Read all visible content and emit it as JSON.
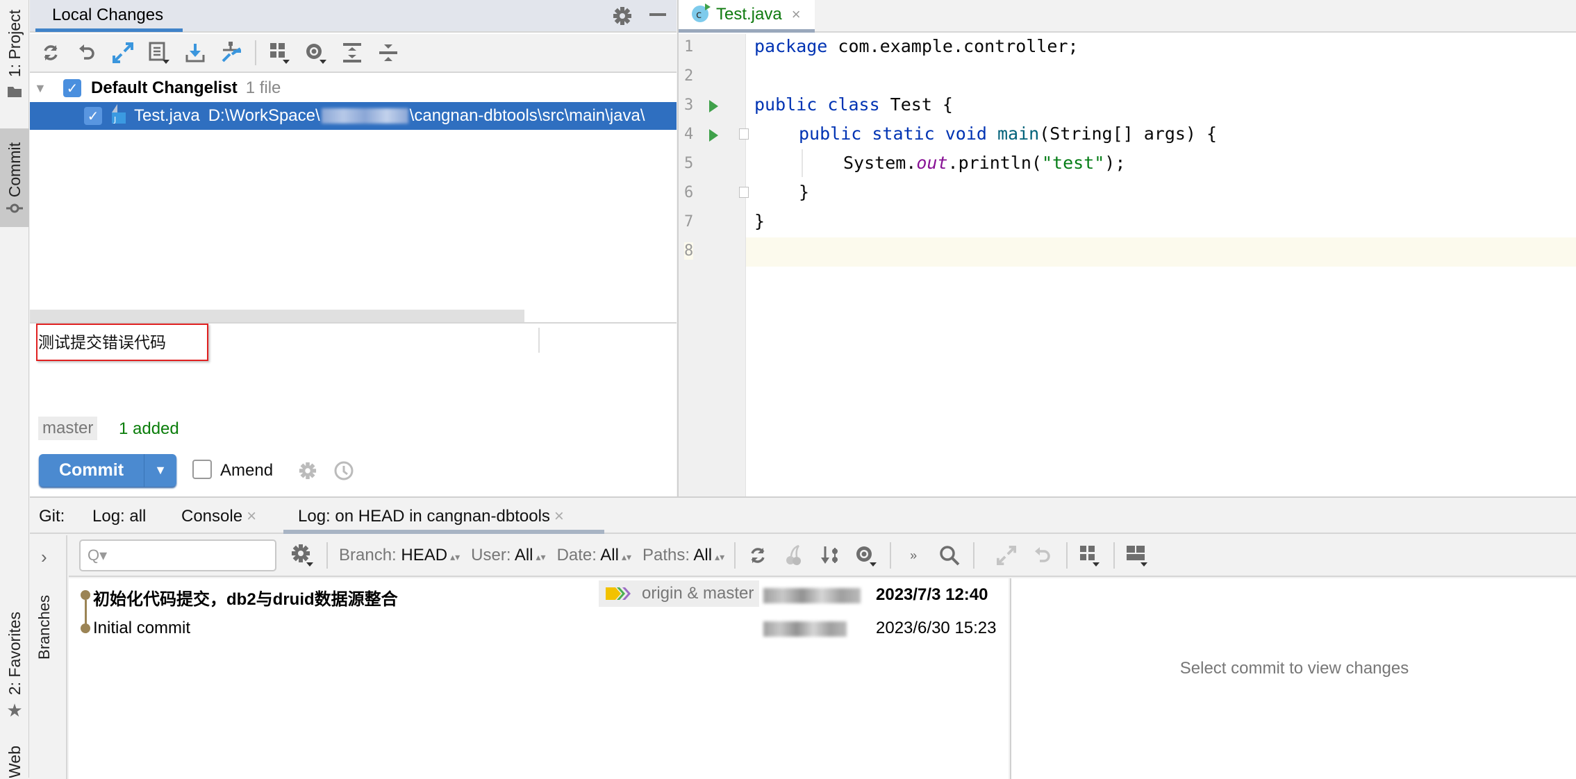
{
  "left_stripe": {
    "project_tab": "1: Project",
    "commit_tab": "Commit",
    "favorites_tab": "2: Favorites",
    "web_tab": "Web"
  },
  "local_changes": {
    "title": "Local Changes",
    "toolbar": [
      "refresh",
      "rollback",
      "show-diff",
      "changelist",
      "update",
      "shelve",
      "group-by",
      "view-options",
      "expand-all",
      "collapse-all"
    ],
    "changelist": {
      "name": "Default Changelist",
      "count": "1 file",
      "checked": true
    },
    "files": [
      {
        "name": "Test.java",
        "path_prefix": "D:\\WorkSpace\\",
        "path_suffix": "\\cangnan-dbtools\\src\\main\\java\\",
        "checked": true
      }
    ],
    "commit_message": "测试提交错误代码",
    "branch": "master",
    "status": "1 added",
    "commit_button": "Commit",
    "amend_label": "Amend",
    "amend_checked": false
  },
  "editor": {
    "tab": "Test.java",
    "lines": [
      {
        "n": "1"
      },
      {
        "n": "2"
      },
      {
        "n": "3"
      },
      {
        "n": "4"
      },
      {
        "n": "5"
      },
      {
        "n": "6"
      },
      {
        "n": "7"
      },
      {
        "n": "8"
      }
    ],
    "code": {
      "l1_kw": "package",
      "l1_rest": " com.example.controller;",
      "l3_kw": "public class",
      "l3_rest": " Test {",
      "l4_kw": "public static void",
      "l4_fn": "main",
      "l4_rest": "(String[] args) {",
      "l5_a": "System.",
      "l5_field": "out",
      "l5_b": ".println(",
      "l5_str": "\"test\"",
      "l5_c": ");",
      "l6": "}",
      "l7": "}"
    }
  },
  "git_window": {
    "label": "Git:",
    "tabs": [
      {
        "label": "Log: all",
        "closable": false
      },
      {
        "label": "Console",
        "closable": true
      },
      {
        "label": "Log: on HEAD in cangnan-dbtools",
        "closable": true,
        "active": true
      }
    ],
    "close_glyph": "×",
    "branches_label": "Branches",
    "search_placeholder": "Q▾",
    "filters": [
      {
        "key": "Branch:",
        "value": "HEAD"
      },
      {
        "key": "User:",
        "value": "All"
      },
      {
        "key": "Date:",
        "value": "All"
      },
      {
        "key": "Paths:",
        "value": "All"
      }
    ],
    "commits": [
      {
        "subject": "初始化代码提交，db2与druid数据源整合",
        "refs": "origin & master",
        "date": "2023/7/3 12:40",
        "bold": true
      },
      {
        "subject": "Initial commit",
        "refs": "",
        "date": "2023/6/30 15:23",
        "bold": false
      }
    ],
    "details_empty": "Select commit to view changes"
  },
  "colors": {
    "accent": "#4083c9",
    "selection": "#2f6fc0",
    "commit_button": "#4b8ad0",
    "added_green": "#0a7d0a",
    "graph": "#9b8455",
    "highlight_box": "#e02020"
  }
}
